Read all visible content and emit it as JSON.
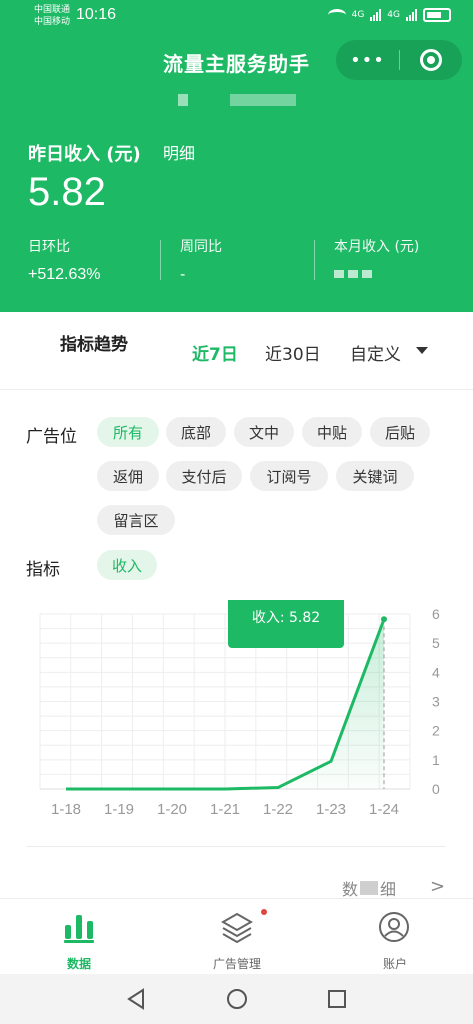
{
  "status_bar": {
    "carrier1": "中国联通",
    "carrier2": "中国移动",
    "time": "10:16",
    "signal1": "4G",
    "signal2": "4G"
  },
  "header": {
    "title": "流量主服务助手",
    "menu_dots": "•••",
    "income_label": "昨日收入 (元)",
    "detail_link": "明细",
    "income_value": "5.82",
    "stats": [
      {
        "label": "日环比",
        "value": "+512.63%"
      },
      {
        "label": "周同比",
        "value": "-"
      },
      {
        "label": "本月收入 (元)",
        "value": ""
      }
    ]
  },
  "trend": {
    "title": "指标趋势",
    "ranges": [
      "近7日",
      "近30日",
      "自定义"
    ],
    "active_range": "近7日"
  },
  "filters": {
    "ad_position_label": "广告位",
    "ad_positions": [
      "所有",
      "底部",
      "文中",
      "中贴",
      "后贴",
      "返佣",
      "支付后",
      "订阅号",
      "关键词",
      "留言区"
    ],
    "active_position": "所有",
    "metric_label": "指标",
    "metrics": [
      "收入"
    ],
    "active_metric": "收入"
  },
  "chart_data": {
    "type": "area",
    "categories": [
      "1-18",
      "1-19",
      "1-20",
      "1-21",
      "1-22",
      "1-23",
      "1-24"
    ],
    "series": [
      {
        "name": "收入",
        "values": [
          0,
          0,
          0,
          0,
          0.05,
          0.95,
          5.82
        ]
      }
    ],
    "ylim": [
      0,
      6
    ],
    "yticks": [
      "0",
      "1",
      "2",
      "3",
      "4",
      "5",
      "6"
    ],
    "tooltip": "收入: 5.82",
    "color": "#1db965",
    "grid": true
  },
  "footer_link": {
    "label_start": "数",
    "label_end": "细",
    "chevron": ">"
  },
  "bottom_nav": {
    "items": [
      {
        "label": "数据",
        "icon": "bar-chart-icon"
      },
      {
        "label": "广告管理",
        "icon": "layers-icon"
      },
      {
        "label": "账户",
        "icon": "user-icon"
      }
    ]
  },
  "colors": {
    "brand": "#1db965",
    "brand_dark": "#17a257",
    "badge": "#e0443b"
  }
}
